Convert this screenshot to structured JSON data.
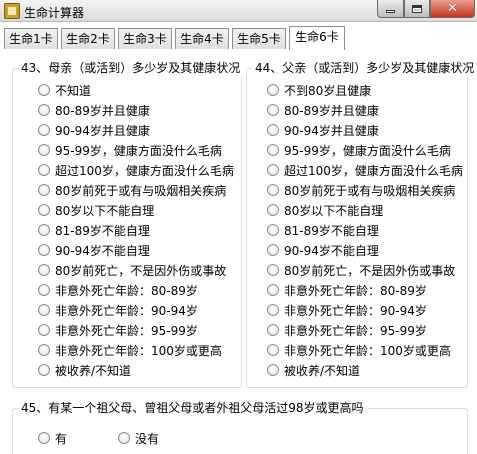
{
  "window": {
    "title": "生命计算器"
  },
  "tabs": [
    "生命1卡",
    "生命2卡",
    "生命3卡",
    "生命4卡",
    "生命5卡",
    "生命6卡"
  ],
  "active_tab": "生命6卡",
  "q43": {
    "title": "43、母亲（或活到）多少岁及其健康状况",
    "options": [
      "不知道",
      "80-89岁并且健康",
      "90-94岁并且健康",
      "95-99岁，健康方面没什么毛病",
      "超过100岁，健康方面没什么毛病",
      "80岁前死于或有与吸烟相关疾病",
      "80岁以下不能自理",
      "81-89岁不能自理",
      "90-94岁不能自理",
      "80岁前死亡，不是因外伤或事故",
      "非意外死亡年龄：80-89岁",
      "非意外死亡年龄：90-94岁",
      "非意外死亡年龄：95-99岁",
      "非意外死亡年龄：100岁或更高",
      "被收养/不知道"
    ]
  },
  "q44": {
    "title": "44、父亲（或活到）多少岁及其健康状况",
    "options": [
      "不到80岁且健康",
      "80-89岁并且健康",
      "90-94岁并且健康",
      "95-99岁，健康方面没什么毛病",
      "超过100岁，健康方面没什么毛病",
      "80岁前死于或有与吸烟相关疾病",
      "80岁以下不能自理",
      "81-89岁不能自理",
      "90-94岁不能自理",
      "80岁前死亡，不是因外伤或事故",
      "非意外死亡年龄：80-89岁",
      "非意外死亡年龄：90-94岁",
      "非意外死亡年龄：95-99岁",
      "非意外死亡年龄：100岁或更高",
      "被收养/不知道"
    ]
  },
  "q45": {
    "title": "45、有某一个祖父母、曾祖父母或者外祖父母活过98岁或更高吗",
    "options": [
      "有",
      "没有"
    ]
  }
}
